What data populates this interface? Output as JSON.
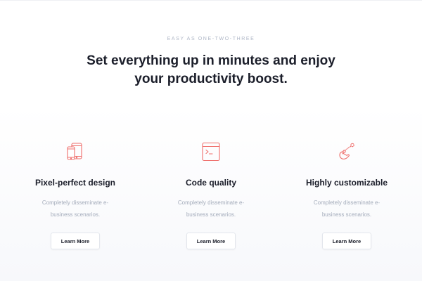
{
  "section": {
    "eyebrow": "EASY AS ONE-TWO-THREE",
    "headline_line1": "Set everything up in minutes and enjoy",
    "headline_line2": "your productivity boost."
  },
  "features": [
    {
      "icon": "devices-icon",
      "title": "Pixel-perfect design",
      "desc_line1": "Completely disseminate e-",
      "desc_line2": "business scenarios.",
      "button": "Learn More"
    },
    {
      "icon": "terminal-icon",
      "title": "Code quality",
      "desc_line1": "Completely disseminate e-",
      "desc_line2": "business scenarios.",
      "button": "Learn More"
    },
    {
      "icon": "pointer-gesture-icon",
      "title": "Highly customizable",
      "desc_line1": "Completely disseminate e-",
      "desc_line2": "business scenarios.",
      "button": "Learn More"
    }
  ],
  "colors": {
    "accent": "#ef6f6c",
    "heading": "#1b1e2a",
    "muted": "#a4acbb",
    "eyebrow": "#aeb6c6"
  }
}
